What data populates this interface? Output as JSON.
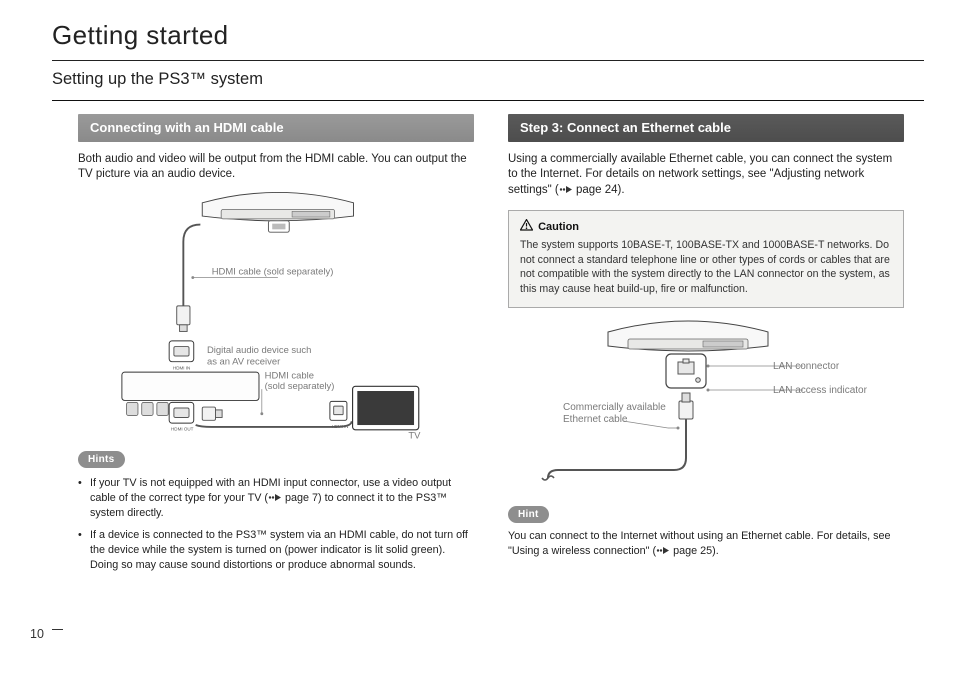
{
  "page_number": "10",
  "section_title": "Getting started",
  "subsection_title": "Setting up the PS3™ system",
  "left": {
    "heading": "Connecting with an HDMI cable",
    "intro": "Both audio and video will be output from the HDMI cable. You can output the TV picture via an audio device.",
    "diagram": {
      "hdmi_cable_label": "HDMI cable (sold separately)",
      "audio_device_label": "Digital audio device such as an AV receiver",
      "hdmi_cable2_label": "HDMI cable\n(sold separately)",
      "tv_label": "TV"
    },
    "hints_label": "Hints",
    "hints": [
      "If your TV is not equipped with an HDMI input connector, use a video output cable of the correct type for your TV (   page 7) to connect it to the PS3™ system directly.",
      "If a device is connected to the PS3™ system via an HDMI cable, do not turn off the device while the system is turned on (power indicator is lit solid green). Doing so may cause sound distortions or produce abnormal sounds."
    ]
  },
  "right": {
    "heading": "Step 3: Connect an Ethernet cable",
    "intro_a": "Using a commercially available Ethernet cable, you can connect the system to the Internet. For details on network settings, see \"Adjusting network settings\" (",
    "intro_b": " page 24).",
    "caution": {
      "title": "Caution",
      "text": "The system supports 10BASE-T, 100BASE-TX and 1000BASE-T networks. Do not connect a standard telephone line or other types of cords or cables that are not compatible with the system directly to the LAN connector on the system, as this may cause heat build-up, fire or malfunction."
    },
    "diagram": {
      "lan_connector_label": "LAN connector",
      "lan_indicator_label": "LAN access indicator",
      "ethernet_cable_label": "Commercially available\nEthernet cable"
    },
    "hint_label": "Hint",
    "hint_a": "You can connect to the Internet without using an Ethernet cable. For details, see \"Using a wireless connection\" (",
    "hint_b": " page 25)."
  }
}
